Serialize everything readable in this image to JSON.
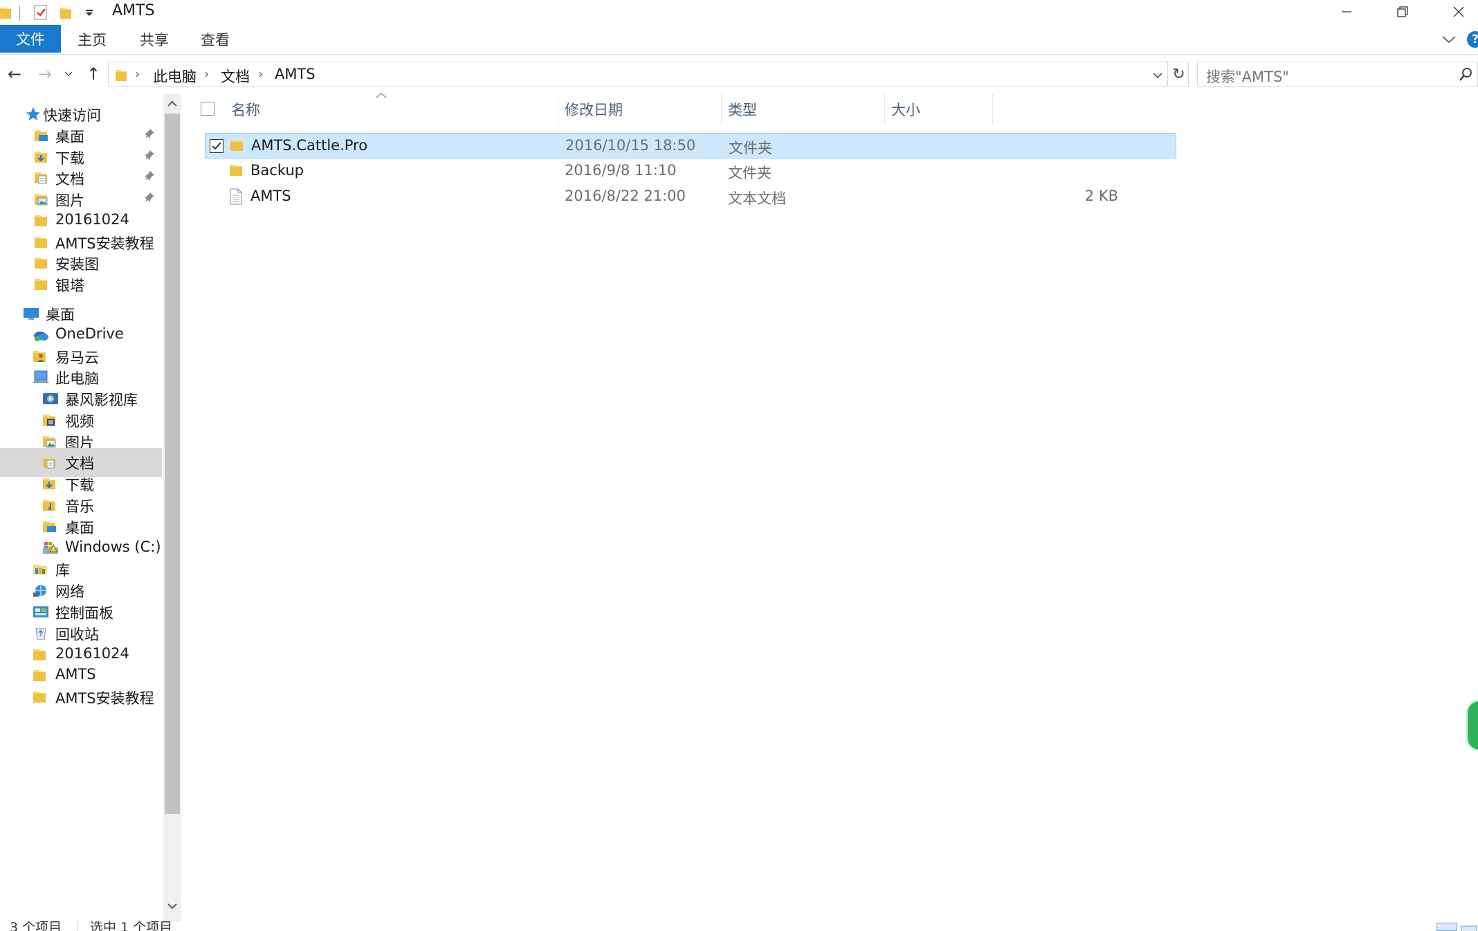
{
  "window": {
    "title": "AMTS",
    "controls": {
      "minimize": "—",
      "maximize": "❐",
      "close": "✕"
    }
  },
  "ribbon": {
    "tabs": [
      "文件",
      "主页",
      "共享",
      "查看"
    ],
    "help": "?"
  },
  "address": {
    "breadcrumb": [
      "此电脑",
      "文档",
      "AMTS"
    ],
    "refresh": "↻"
  },
  "search": {
    "placeholder": "搜索\"AMTS\""
  },
  "nav": {
    "back": "←",
    "forward": "→",
    "recent": "⌄",
    "up": "↑",
    "items": [
      {
        "label": "快速访问",
        "icon": "star-icon",
        "pinned": false
      },
      {
        "label": "桌面",
        "icon": "desktop-folder-icon",
        "pinned": true
      },
      {
        "label": "下载",
        "icon": "downloads-folder-icon",
        "pinned": true
      },
      {
        "label": "文档",
        "icon": "documents-folder-icon",
        "pinned": true
      },
      {
        "label": "图片",
        "icon": "pictures-folder-icon",
        "pinned": true
      },
      {
        "label": "20161024",
        "icon": "folder-icon",
        "pinned": false
      },
      {
        "label": "AMTS安装教程",
        "icon": "folder-icon",
        "pinned": false
      },
      {
        "label": "安装图",
        "icon": "folder-icon",
        "pinned": false
      },
      {
        "label": "银塔",
        "icon": "folder-icon",
        "pinned": false
      },
      {
        "label": "桌面",
        "icon": "desktop-icon",
        "pinned": false
      },
      {
        "label": "OneDrive",
        "icon": "onedrive-icon",
        "pinned": false
      },
      {
        "label": "易马云",
        "icon": "user-folder-icon",
        "pinned": false
      },
      {
        "label": "此电脑",
        "icon": "computer-icon",
        "pinned": false
      },
      {
        "label": "暴风影视库",
        "icon": "media-library-icon",
        "pinned": false
      },
      {
        "label": "视频",
        "icon": "videos-folder-icon",
        "pinned": false
      },
      {
        "label": "图片",
        "icon": "pictures-folder-icon",
        "pinned": false
      },
      {
        "label": "文档",
        "icon": "documents-folder-icon",
        "pinned": false,
        "selected": true
      },
      {
        "label": "下载",
        "icon": "downloads-folder-icon",
        "pinned": false
      },
      {
        "label": "音乐",
        "icon": "music-folder-icon",
        "pinned": false
      },
      {
        "label": "桌面",
        "icon": "desktop-folder-icon",
        "pinned": false
      },
      {
        "label": "Windows (C:)",
        "icon": "drive-icon",
        "pinned": false
      },
      {
        "label": "库",
        "icon": "libraries-icon",
        "pinned": false
      },
      {
        "label": "网络",
        "icon": "network-icon",
        "pinned": false
      },
      {
        "label": "控制面板",
        "icon": "control-panel-icon",
        "pinned": false
      },
      {
        "label": "回收站",
        "icon": "recycle-bin-icon",
        "pinned": false
      },
      {
        "label": "20161024",
        "icon": "folder-icon",
        "pinned": false
      },
      {
        "label": "AMTS",
        "icon": "folder-icon",
        "pinned": false
      },
      {
        "label": "AMTS安装教程",
        "icon": "folder-icon",
        "pinned": false
      }
    ]
  },
  "files": {
    "columns": [
      "名称",
      "修改日期",
      "类型",
      "大小"
    ],
    "rows": [
      {
        "name": "AMTS.Cattle.Pro",
        "date": "2016/10/15 18:50",
        "type": "文件夹",
        "size": "",
        "icon": "folder-icon",
        "selected": true,
        "checked": true
      },
      {
        "name": "Backup",
        "date": "2016/9/8 11:10",
        "type": "文件夹",
        "size": "",
        "icon": "folder-icon",
        "selected": false,
        "checked": false
      },
      {
        "name": "AMTS",
        "date": "2016/8/22 21:00",
        "type": "文本文档",
        "size": "2 KB",
        "icon": "text-file-icon",
        "selected": false,
        "checked": false
      }
    ]
  },
  "status": {
    "item_count": "3 个项目",
    "selected_count": "选中 1 个项目"
  },
  "colors": {
    "accent": "#1979ca",
    "selection": "#cce8ff",
    "selection_border": "#99d1ff",
    "folder": "#f8d775",
    "nav_selected": "#d9d9d9"
  }
}
